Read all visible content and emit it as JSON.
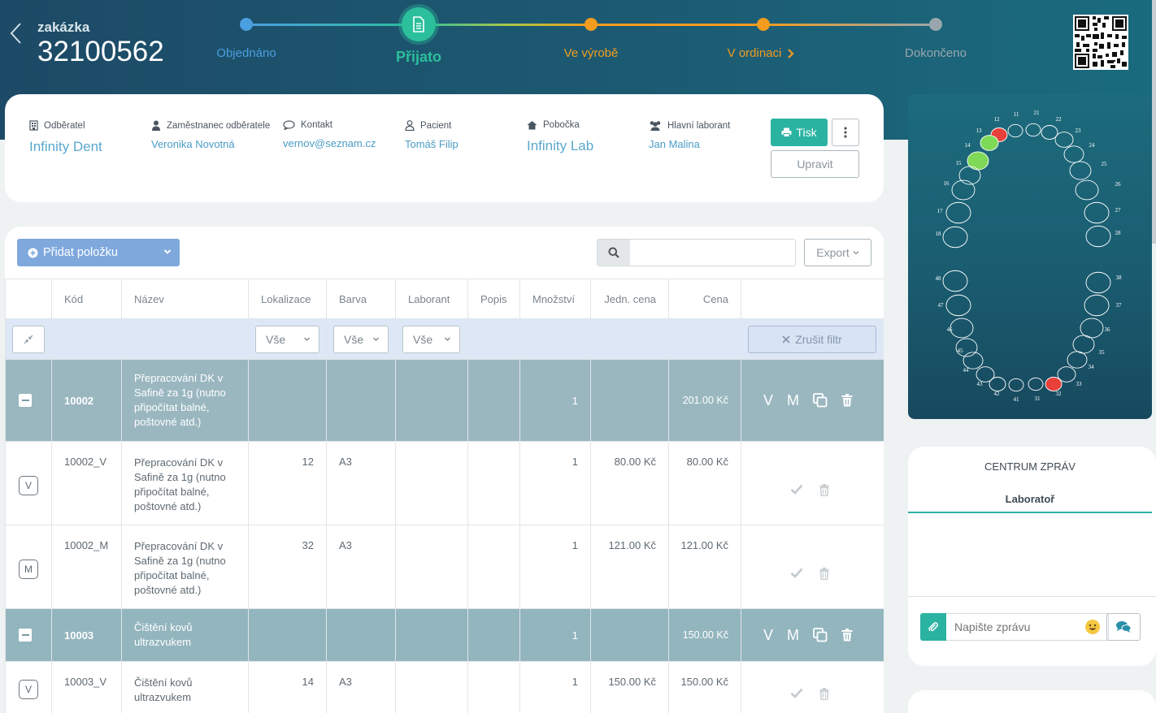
{
  "header": {
    "order_label": "zakázka",
    "order_number": "32100562",
    "steps": [
      {
        "label": "Objednáno",
        "state": "done",
        "color": "#4a9fe0"
      },
      {
        "label": "Přijato",
        "state": "current",
        "color": "#2bbf9c"
      },
      {
        "label": "Ve výrobě",
        "state": "next",
        "color": "#f39c1f"
      },
      {
        "label": "V ordinaci",
        "state": "next",
        "color": "#f39c1f"
      },
      {
        "label": "Dokončeno",
        "state": "future",
        "color": "#9aa6ad"
      }
    ]
  },
  "info": {
    "customer": {
      "label": "Odběratel",
      "value": "Infinity Dent"
    },
    "employee": {
      "label": "Zaměstnanec odběratele",
      "value": "Veronika Novotná"
    },
    "contact": {
      "label": "Kontakt",
      "value": "vernov@seznam.cz"
    },
    "patient": {
      "label": "Pacient",
      "value": "Tomáš Filip"
    },
    "branch": {
      "label": "Pobočka",
      "value": "Infinity Lab"
    },
    "lab_head": {
      "label": "Hlavní laborant",
      "value": "Jan Malina"
    },
    "print_label": "Tisk",
    "edit_label": "Upravit"
  },
  "toolbar": {
    "add_label": "Přidat položku",
    "search_placeholder": "",
    "export_label": "Export"
  },
  "table": {
    "columns": [
      "Kód",
      "Název",
      "Lokalizace",
      "Barva",
      "Laborant",
      "Popis",
      "Množství",
      "Jedn. cena",
      "Cena"
    ],
    "filter_all": "Vše",
    "clear_filter": "Zrušit filtr",
    "action_v": "V",
    "action_m": "M",
    "rows": [
      {
        "type": "group",
        "code": "10002",
        "name": "Přepracování DK v Safině za 1g (nutno připočítat balné, poštovné atd.)",
        "qty": "1",
        "price": "201.00 Kč"
      },
      {
        "type": "sub",
        "badge": "V",
        "code": "10002_V",
        "name": "Přepracování DK v Safině za 1g (nutno připočítat balné, poštovné atd.)",
        "loc": "12",
        "color": "A3",
        "qty": "1",
        "unit": "80.00 Kč",
        "price": "80.00 Kč"
      },
      {
        "type": "sub",
        "badge": "M",
        "code": "10002_M",
        "name": "Přepracování DK v Safině za 1g (nutno připočítat balné, poštovné atd.)",
        "loc": "32",
        "color": "A3",
        "qty": "1",
        "unit": "121.00 Kč",
        "price": "121.00 Kč"
      },
      {
        "type": "group",
        "code": "10003",
        "name": "Čištění kovů ultrazvukem",
        "qty": "1",
        "price": "150.00 Kč"
      },
      {
        "type": "sub",
        "badge": "V",
        "code": "10003_V",
        "name": "Čištění kovů ultrazvukem",
        "loc": "14",
        "color": "A3",
        "qty": "1",
        "unit": "150.00 Kč",
        "price": "150.00 Kč"
      }
    ]
  },
  "teeth": {
    "upper_right": [
      "11",
      "12",
      "13",
      "14",
      "15",
      "16",
      "17",
      "18"
    ],
    "upper_left": [
      "21",
      "22",
      "23",
      "24",
      "25",
      "26",
      "27",
      "28"
    ],
    "lower_left": [
      "31",
      "32",
      "33",
      "34",
      "35",
      "36",
      "37",
      "38"
    ],
    "lower_right": [
      "41",
      "42",
      "43",
      "44",
      "45",
      "46",
      "47",
      "48"
    ],
    "highlight_green": [
      "13",
      "14"
    ],
    "highlight_red": [
      "12",
      "32"
    ],
    "green_color": "#7ed957",
    "red_color": "#e8403a"
  },
  "chat": {
    "title": "CENTRUM ZPRÁV",
    "tab": "Laboratoř",
    "placeholder": "Napište zprávu"
  }
}
